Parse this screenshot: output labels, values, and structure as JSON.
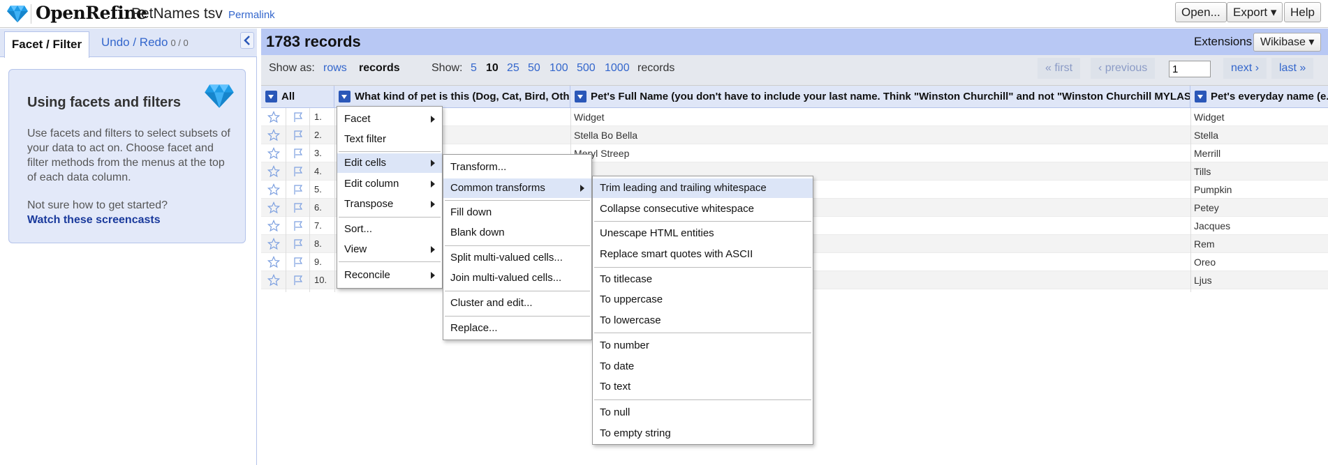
{
  "header": {
    "app_name": "OpenRefine",
    "project_name": "PetNames tsv",
    "permalink": "Permalink",
    "buttons": {
      "open": "Open...",
      "export": "Export ▾",
      "help": "Help"
    }
  },
  "left_panel": {
    "tabs": {
      "facet": "Facet / Filter",
      "undo": "Undo / Redo",
      "undo_count": "0 / 0"
    },
    "help": {
      "title": "Using facets and filters",
      "text": "Use facets and filters to select subsets of your data to act on. Choose facet and filter methods from the menus at the top of each data column.",
      "question": "Not sure how to get started?",
      "link": "Watch these screencasts"
    }
  },
  "summary": {
    "record_count": "1783 records",
    "extensions_label": "Extensions",
    "wikibase_button": "Wikibase ▾"
  },
  "view_bar": {
    "show_as_label": "Show as:",
    "rows": "rows",
    "records": "records",
    "show_label": "Show:",
    "page_sizes": [
      "5",
      "10",
      "25",
      "50",
      "100",
      "500",
      "1000"
    ],
    "selected_size": "10",
    "records_suffix": "records",
    "first": "« first",
    "previous": "‹ previous",
    "page_value": "1",
    "next": "next ›",
    "last": "last »"
  },
  "table": {
    "all_label": "All",
    "columns": [
      "What kind of pet is this (Dog, Cat, Bird, Other)",
      "Pet's Full Name (you don't have to include your last name. Think \"Winston Churchill\" and not \"Winston Churchill MYLASTNAME\")",
      "Pet's everyday name (e.g"
    ],
    "rows": [
      {
        "num": "1.",
        "full": "Widget",
        "every": "Widget"
      },
      {
        "num": "2.",
        "full": "Stella Bo Bella",
        "every": "Stella"
      },
      {
        "num": "3.",
        "full": "Meryl Streep",
        "every": "Merrill"
      },
      {
        "num": "4.",
        "full": "",
        "every": "Tills"
      },
      {
        "num": "5.",
        "full": "",
        "every": "Pumpkin"
      },
      {
        "num": "6.",
        "full": "",
        "every": "Petey"
      },
      {
        "num": "7.",
        "full": "",
        "every": "Jacques"
      },
      {
        "num": "8.",
        "full": "",
        "every": "Rem"
      },
      {
        "num": "9.",
        "full": "",
        "every": "Oreo"
      },
      {
        "num": "10.",
        "full": "",
        "every": "Ljus"
      }
    ]
  },
  "column_menu": {
    "facet": "Facet",
    "text_filter": "Text filter",
    "edit_cells": "Edit cells",
    "edit_column": "Edit column",
    "transpose": "Transpose",
    "sort": "Sort...",
    "view": "View",
    "reconcile": "Reconcile"
  },
  "edit_cells_menu": {
    "transform": "Transform...",
    "common_transforms": "Common transforms",
    "fill_down": "Fill down",
    "blank_down": "Blank down",
    "split": "Split multi-valued cells...",
    "join": "Join multi-valued cells...",
    "cluster": "Cluster and edit...",
    "replace": "Replace..."
  },
  "transforms_menu": {
    "trim": "Trim leading and trailing whitespace",
    "collapse": "Collapse consecutive whitespace",
    "unescape": "Unescape HTML entities",
    "smart_quotes": "Replace smart quotes with ASCII",
    "titlecase": "To titlecase",
    "uppercase": "To uppercase",
    "lowercase": "To lowercase",
    "number": "To number",
    "date": "To date",
    "text": "To text",
    "null": "To null",
    "empty": "To empty string"
  },
  "colors": {
    "accent": "#3366cc",
    "header_blue": "#b8c8f4",
    "panel_blue": "#e3e9f9",
    "menu_highlight": "#dce5f7"
  }
}
